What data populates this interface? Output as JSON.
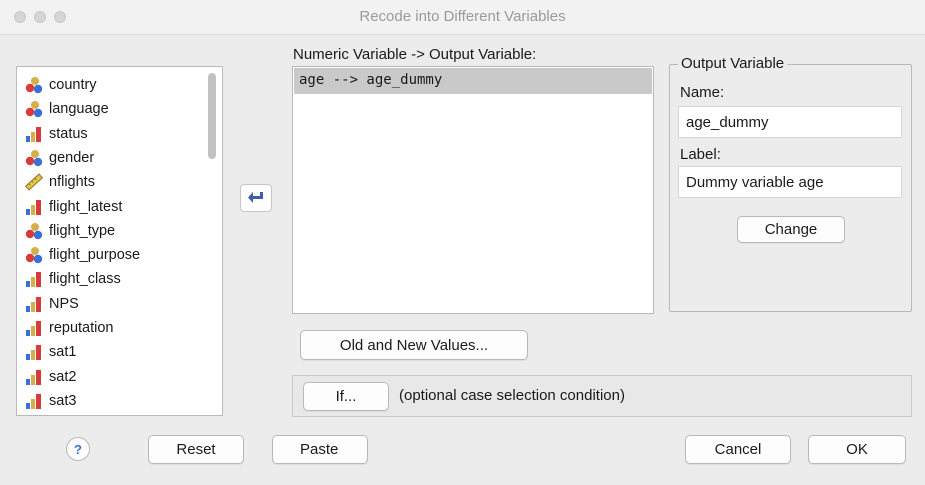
{
  "window": {
    "title": "Recode into Different Variables"
  },
  "variables": [
    {
      "label": "country",
      "icon": "nominal-icon"
    },
    {
      "label": "language",
      "icon": "nominal-icon"
    },
    {
      "label": "status",
      "icon": "ordinal-icon"
    },
    {
      "label": "gender",
      "icon": "nominal-icon"
    },
    {
      "label": "nflights",
      "icon": "scale-icon"
    },
    {
      "label": "flight_latest",
      "icon": "ordinal-icon"
    },
    {
      "label": "flight_type",
      "icon": "nominal-icon"
    },
    {
      "label": "flight_purpose",
      "icon": "nominal-icon"
    },
    {
      "label": "flight_class",
      "icon": "ordinal-icon"
    },
    {
      "label": "NPS",
      "icon": "ordinal-icon"
    },
    {
      "label": "reputation",
      "icon": "ordinal-icon"
    },
    {
      "label": "sat1",
      "icon": "ordinal-icon"
    },
    {
      "label": "sat2",
      "icon": "ordinal-icon"
    },
    {
      "label": "sat3",
      "icon": "ordinal-icon"
    }
  ],
  "numeric_output": {
    "header": "Numeric Variable -> Output Variable:",
    "rows": [
      "age --> age_dummy"
    ]
  },
  "output_variable": {
    "legend": "Output Variable",
    "name_label": "Name:",
    "name_value": "age_dummy",
    "label_label": "Label:",
    "label_value": "Dummy variable age",
    "change_button": "Change"
  },
  "old_new_button": "Old and New Values...",
  "if_section": {
    "button": "If...",
    "description": "(optional case selection condition)"
  },
  "footer": {
    "help": "?",
    "reset": "Reset",
    "paste": "Paste",
    "cancel": "Cancel",
    "ok": "OK"
  }
}
